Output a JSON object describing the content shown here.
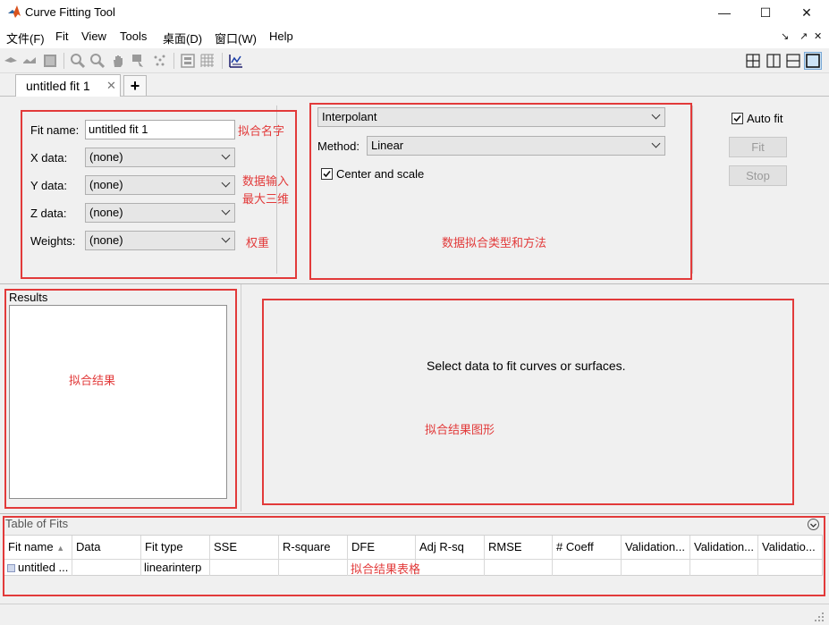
{
  "window": {
    "title": "Curve Fitting Tool",
    "minimize": "—",
    "maximize": "☐",
    "close": "✕"
  },
  "menu": {
    "items": [
      "文件(F)",
      "Fit",
      "View",
      "Tools",
      "桌面(D)",
      "窗口(W)",
      "Help"
    ],
    "right_icons": [
      "↘",
      "↗",
      "✕"
    ]
  },
  "tabs": {
    "active_label": "untitled fit 1",
    "close_glyph": "✕",
    "add_glyph": "+"
  },
  "fit_panel": {
    "fit_name_label": "Fit name:",
    "fit_name_value": "untitled fit 1",
    "x_label": "X data:",
    "x_value": "(none)",
    "y_label": "Y data:",
    "y_value": "(none)",
    "z_label": "Z data:",
    "z_value": "(none)",
    "weights_label": "Weights:",
    "weights_value": "(none)",
    "fit_type_value": "Interpolant",
    "method_label": "Method:",
    "method_value": "Linear",
    "center_scale_label": "Center and scale",
    "center_scale_checked": true,
    "auto_fit_label": "Auto fit",
    "auto_fit_checked": true,
    "fit_button": "Fit",
    "stop_button": "Stop"
  },
  "annotations": {
    "fit_name": "拟合名字",
    "data_input_1": "数据输入",
    "data_input_2": "最大三维",
    "weights": "权重",
    "fit_type_method": "数据拟合类型和方法",
    "results": "拟合结果",
    "plot": "拟合结果图形",
    "table": "拟合结果表格"
  },
  "results": {
    "title": "Results"
  },
  "plot": {
    "message": "Select data to fit curves or surfaces."
  },
  "table_of_fits": {
    "title": "Table of Fits",
    "columns": [
      "Fit name",
      "Data",
      "Fit type",
      "SSE",
      "R-square",
      "DFE",
      "Adj R-sq",
      "RMSE",
      "# Coeff",
      "Validation...",
      "Validation...",
      "Validatio..."
    ],
    "rows": [
      [
        "untitled ...",
        "",
        "linearinterp",
        "",
        "",
        "",
        "",
        "",
        "",
        "",
        "",
        ""
      ]
    ]
  },
  "colors": {
    "annotation_red": "#e23a3a",
    "matlab_orange": "#d9531e"
  }
}
